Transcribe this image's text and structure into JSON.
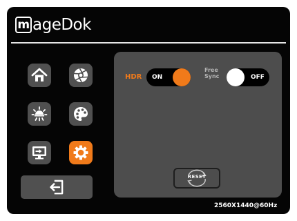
{
  "brand": {
    "mark": "m",
    "rest": "ageDok"
  },
  "sidebar": {
    "items": [
      {
        "id": "home",
        "icon": "home-icon",
        "active": false
      },
      {
        "id": "picture",
        "icon": "aperture-icon",
        "active": false
      },
      {
        "id": "brightness",
        "icon": "brightness-icon",
        "active": false
      },
      {
        "id": "color",
        "icon": "palette-icon",
        "active": false
      },
      {
        "id": "input",
        "icon": "input-source-icon",
        "active": false
      },
      {
        "id": "settings",
        "icon": "gear-icon",
        "active": true
      }
    ],
    "exit_icon": "exit-icon"
  },
  "settings": {
    "hdr": {
      "label": "HDR",
      "state": "ON"
    },
    "freesync": {
      "label_line1": "Free",
      "label_line2": "Sync",
      "state": "OFF"
    },
    "reset_label": "RESET"
  },
  "status": {
    "resolution": "2560X1440@60Hz"
  },
  "colors": {
    "accent": "#f07a1a",
    "tile": "#505050",
    "panel": "#4d4d4d",
    "background": "#050505",
    "knob_off": "#ffffff"
  }
}
